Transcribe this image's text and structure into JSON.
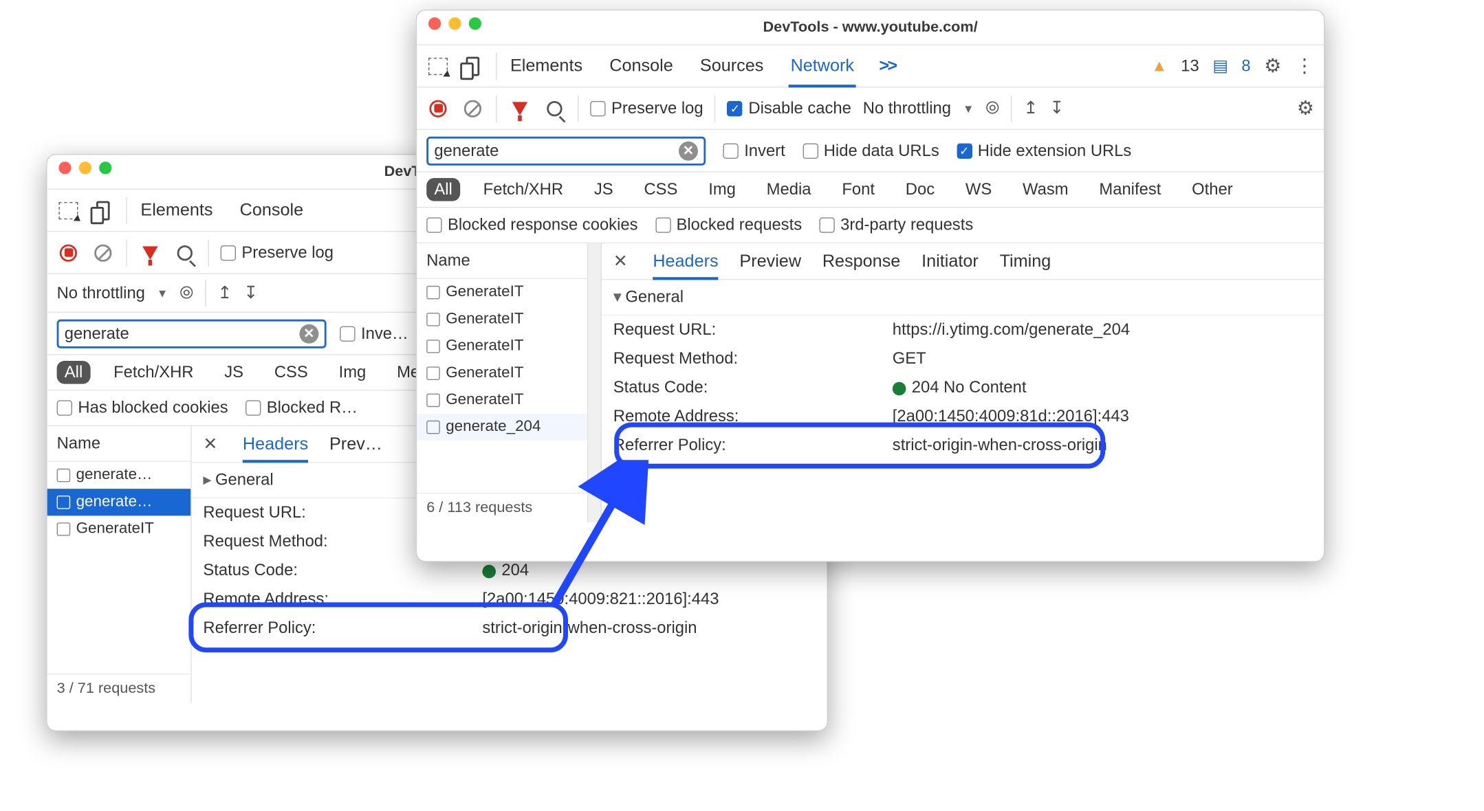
{
  "windows": {
    "back": {
      "title": "DevTools - w…"
    },
    "front": {
      "title": "DevTools - www.youtube.com/"
    }
  },
  "tabs": [
    "Elements",
    "Console",
    "Sources",
    "Network"
  ],
  "tabs_more": ">>",
  "badges": {
    "warn": "13",
    "msg": "8"
  },
  "toolbar": {
    "preserve_log": "Preserve log",
    "disable_cache": "Disable cache",
    "no_throttling": "No throttling"
  },
  "filter": {
    "value": "generate",
    "invert": "Invert",
    "hide_data": "Hide data URLs",
    "hide_ext": "Hide extension URLs"
  },
  "types": [
    "All",
    "Fetch/XHR",
    "JS",
    "CSS",
    "Img",
    "Media",
    "Font",
    "Doc",
    "WS",
    "Wasm",
    "Manifest",
    "Other"
  ],
  "cookie_filters": {
    "blocked_cookies": "Blocked response cookies",
    "blocked_reqs": "Blocked requests",
    "third_party": "3rd-party requests",
    "has_blocked_cookies": "Has blocked cookies",
    "blocked_r": "Blocked R…"
  },
  "columns": {
    "name": "Name"
  },
  "requests_front": [
    "GenerateIT",
    "GenerateIT",
    "GenerateIT",
    "GenerateIT",
    "GenerateIT",
    "generate_204"
  ],
  "requests_back": [
    "generate…",
    "generate…",
    "GenerateIT"
  ],
  "req_count_front": "6 / 113 requests",
  "req_count_back": "3 / 71 requests",
  "detail_tabs": [
    "Headers",
    "Preview",
    "Response",
    "Initiator",
    "Timing"
  ],
  "detail_tabs_short": [
    "Headers",
    "Prev…"
  ],
  "general_label": "General",
  "kv": {
    "request_url": {
      "k": "Request URL:",
      "v": "https://i.ytimg.com/generate_204"
    },
    "request_method": {
      "k": "Request Method:",
      "v": "GET"
    },
    "status_code_k": "Status Code:",
    "status_code_front": "204 No Content",
    "status_code_back": "204",
    "remote_addr_k": "Remote Address:",
    "remote_addr_front": "[2a00:1450:4009:81d::2016]:443",
    "remote_addr_back": "[2a00:1450:4009:821::2016]:443",
    "referrer_k": "Referrer Policy:",
    "referrer_v": "strict-origin-when-cross-origin"
  },
  "back_filter_invert": "Inve…",
  "back_types": [
    "All",
    "Fetch/XHR",
    "JS",
    "CSS",
    "Img",
    "Media…"
  ]
}
